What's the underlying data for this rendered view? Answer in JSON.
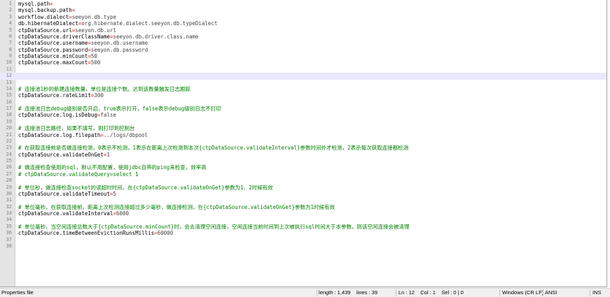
{
  "editor": {
    "current_line": 12,
    "lines": [
      {
        "k": "mysql.path",
        "s": "=",
        "v": ""
      },
      {
        "k": "mysql.backup.path",
        "s": "=",
        "v": ""
      },
      {
        "k": "workflow.dialect",
        "s": "=",
        "v": "seeyon.db.type"
      },
      {
        "k": "db.hibernateDialect",
        "s": "=",
        "v": "org.hibernate.dialect.seeyon.db.typeDialect"
      },
      {
        "k": "ctpDataSource.url",
        "s": "=",
        "v": "seeyon.db.url"
      },
      {
        "k": "ctpDataSource.driverClassName",
        "s": "=",
        "v": "seeyon.db.driver.class.name"
      },
      {
        "k": "ctpDataSource.username",
        "s": "=",
        "v": "seeyon.db.username"
      },
      {
        "k": "ctpDataSource.password",
        "s": "=",
        "v": "seeyon.db.password"
      },
      {
        "k": "ctpDataSource.minCount",
        "s": "=",
        "v": "50"
      },
      {
        "k": "ctpDataSource.maxCount",
        "s": "=",
        "v": "500"
      },
      {},
      {},
      {},
      {
        "c": "# 连接池1秒的新建连接数量，单位是连接个数。达到该数量触发日志跟踪"
      },
      {
        "k": "ctpDataSource.rateLimit",
        "s": "=",
        "v": "300"
      },
      {},
      {
        "c": "# 连接池日志debug级别是否开启，true表示打开，false表示debug级别日志不打印"
      },
      {
        "k": "ctpDataSource.log.isDebug",
        "s": "=",
        "v": "false"
      },
      {},
      {
        "c": "# 连接池日志路径，如果不填写，则打印到控制台"
      },
      {
        "k": "ctpDataSource.log.filepath",
        "s": "=",
        "v": "../logs/dbpool"
      },
      {},
      {
        "c": "# 在获取连接前是否做连接检测，0表示不检测，1表示在距离上次检测到本次{ctpDataSource.validateInterval}参数时间外才检测，2表示每次获取连接都检测"
      },
      {
        "k": "ctpDataSource.validateOnGet",
        "s": "=",
        "v": "1"
      },
      {},
      {
        "c": "# 做连接检查使用的sql，默认不用配置，使用jdbc自带的ping来检查，效率高"
      },
      {
        "c": "# ctpDataSource.validateQuery=select 1"
      },
      {},
      {
        "c": "# 单位秒，做连接检查socket的读超时时间，在{ctpDataSource.validateOnGet}参数为1、2时候有效"
      },
      {
        "k": "ctpDataSource.validateTimeout",
        "s": "=",
        "v": "5"
      },
      {},
      {
        "c": "# 单位毫秒，在获取连接前，距离上次检测连接超过多少毫秒，做连接检测，在{ctpDataSource.validateOnGet}参数为1时候有效"
      },
      {
        "k": "ctpDataSource.validateInterval",
        "s": "=",
        "v": "6000"
      },
      {},
      {
        "c": "# 单位毫秒，当空闲连接总数大于{ctpDataSource.minCount}时，会去清理空闲连接，空闲连接当前时间到上次被执行sql时间大于本参数，则该空闲连接会被清理"
      },
      {
        "k": "ctpDataSource.timeBetweenEvictionRunsMillis",
        "s": "=",
        "v": "60000"
      },
      {},
      {}
    ]
  },
  "status": {
    "file_type": "Properties file",
    "length": "length : 1,439",
    "lines": "lines : 39",
    "position": "Ln : 12    Col : 1    Sel : 0 | 0",
    "eol": "Windows (CR LF)",
    "encoding": "ANSI",
    "mode": "INS"
  }
}
